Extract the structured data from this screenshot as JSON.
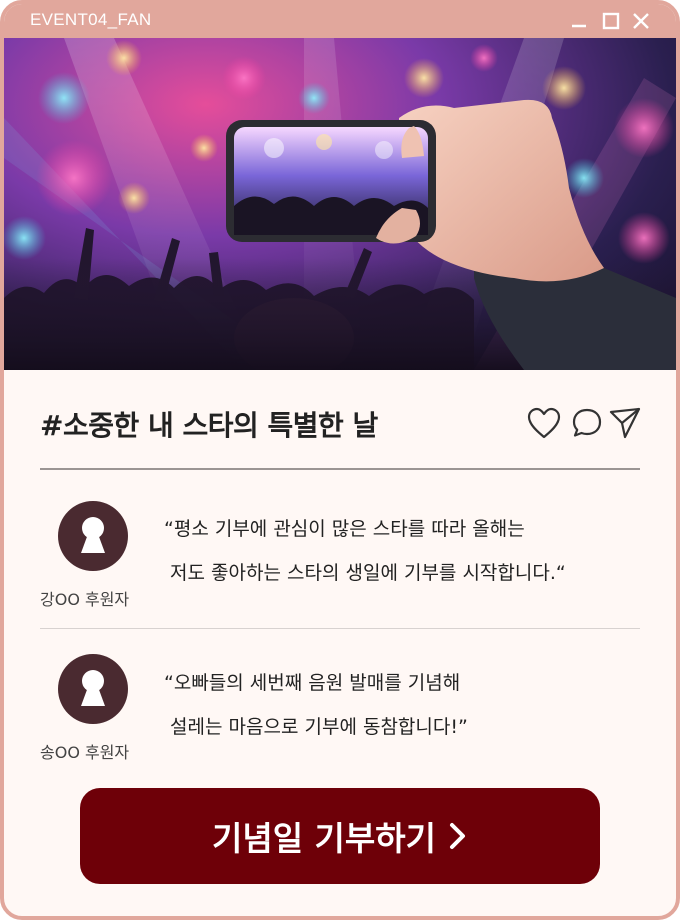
{
  "window": {
    "title": "EVENT04_FAN",
    "controls": [
      "minimize-icon",
      "maximize-icon",
      "close-icon"
    ]
  },
  "hero": {
    "icon": "concert-photo"
  },
  "post": {
    "title": "#소중한 내 스타의 특별한 날",
    "actions": [
      "heart-icon",
      "comment-icon",
      "send-icon"
    ]
  },
  "testimonials": [
    {
      "name": "강OO 후원자",
      "quote_line1": "“평소 기부에 관심이 많은 스타를 따라 올해는",
      "quote_line2": " 저도 좋아하는 스타의 생일에 기부를 시작합니다.“"
    },
    {
      "name": "송OO 후원자",
      "quote_line1": "“오빠들의 세번째 음원 발매를 기념해",
      "quote_line2": " 설레는 마음으로 기부에 동참합니다!”"
    }
  ],
  "cta": {
    "label": "기념일 기부하기",
    "icon": "chevron-right-icon"
  },
  "colors": {
    "frame": "#e1a79c",
    "background": "#fff8f5",
    "cta": "#6e0008",
    "avatar": "#4a2a30"
  }
}
